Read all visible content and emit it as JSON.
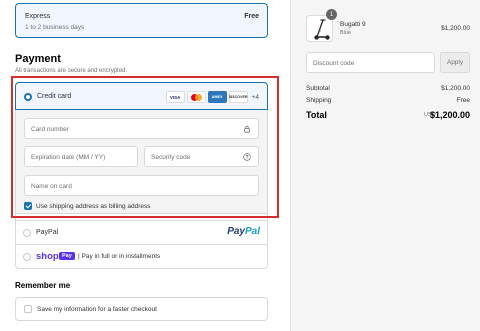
{
  "shipping": {
    "name": "Express",
    "desc": "1 to 2 business days",
    "price": "Free"
  },
  "payment": {
    "heading": "Payment",
    "subtitle": "All transactions are secure and encrypted.",
    "credit_card_label": "Credit card",
    "card_logos": [
      "VISA",
      "mastercard",
      "AMERICAN EXPRESS",
      "DISCOVER"
    ],
    "more_cards": "+4",
    "card_number_placeholder": "Card number",
    "expiration_placeholder": "Expiration date (MM / YY)",
    "security_placeholder": "Security code",
    "name_placeholder": "Name on card",
    "billing_label": "Use shipping address as billing address",
    "billing_checked": true,
    "paypal_label": "PayPal",
    "paypal_logo_a": "Pay",
    "paypal_logo_b": "Pal",
    "shop_word": "shop",
    "shop_badge": "Pay",
    "shop_desc": "| Pay in full or in installments"
  },
  "remember": {
    "heading": "Remember me",
    "label": "Save my information for a faster checkout"
  },
  "summary": {
    "qty": "1",
    "product_name": "Bugatti 9",
    "product_variant": "Blue",
    "product_price": "$1,200.00",
    "discount_placeholder": "Discount code",
    "apply_label": "Apply",
    "subtotal_label": "Subtotal",
    "subtotal_value": "$1,200.00",
    "shipping_label": "Shipping",
    "shipping_value": "Free",
    "total_label": "Total",
    "total_currency": "USD",
    "total_value": "$1,200.00"
  },
  "colors": {
    "accent": "#1773b0",
    "highlight_frame": "#d32f2f",
    "shop_purple": "#5a31f4"
  }
}
